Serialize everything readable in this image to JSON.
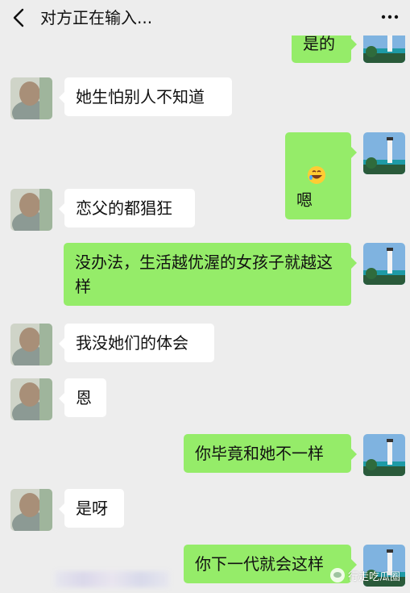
{
  "header": {
    "title": "对方正在输入...",
    "back_icon": "chevron-left-icon",
    "more_icon": "more-dots-icon"
  },
  "messages": [
    {
      "side": "right",
      "text": "是的"
    },
    {
      "side": "left",
      "text": "她生怕别人不知道"
    },
    {
      "side": "right",
      "text": "嗯",
      "emoji": "grinning-sweat-face"
    },
    {
      "side": "left",
      "text": "恋父的都猖狂"
    },
    {
      "side": "right",
      "text": "没办法，生活越优渥的女孩子就越这样"
    },
    {
      "side": "left",
      "text": "我没她们的体会"
    },
    {
      "side": "left",
      "text": "恩"
    },
    {
      "side": "right",
      "text": "你毕竟和她不一样"
    },
    {
      "side": "left",
      "text": "是呀"
    },
    {
      "side": "right",
      "text": "你下一代就会这样"
    }
  ],
  "watermark": {
    "text": "行走吃瓜圈"
  },
  "colors": {
    "background": "#ededed",
    "bubble_self": "#95ec69",
    "bubble_other": "#ffffff"
  }
}
